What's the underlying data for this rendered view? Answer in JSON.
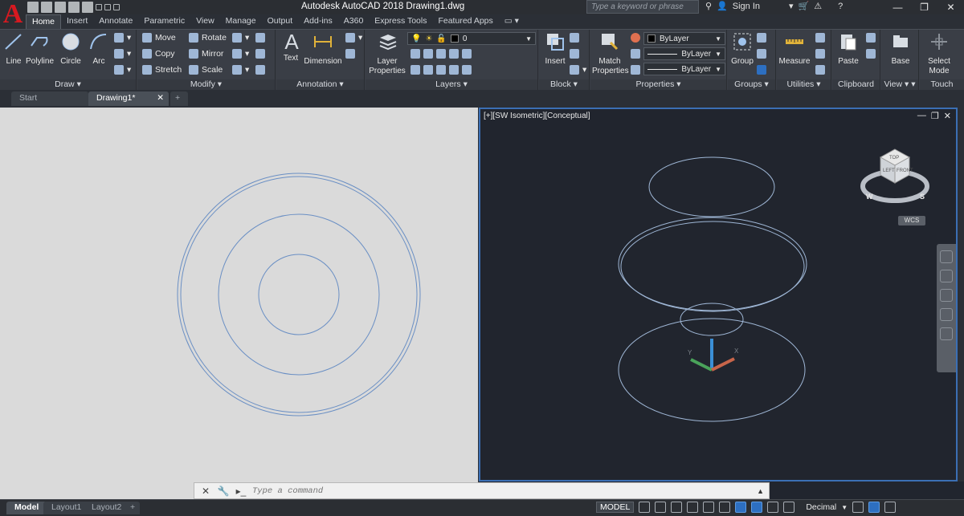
{
  "app": {
    "title": "Autodesk AutoCAD 2018    Drawing1.dwg",
    "logo_letter": "A"
  },
  "search": {
    "placeholder": "Type a keyword or phrase"
  },
  "account": {
    "sign_in": "Sign In"
  },
  "ribbon_tabs": [
    "Home",
    "Insert",
    "Annotate",
    "Parametric",
    "View",
    "Manage",
    "Output",
    "Add-ins",
    "A360",
    "Express Tools",
    "Featured Apps"
  ],
  "draw": {
    "title": "Draw",
    "line": "Line",
    "polyline": "Polyline",
    "circle": "Circle",
    "arc": "Arc"
  },
  "modify": {
    "title": "Modify",
    "move": "Move",
    "rotate": "Rotate",
    "copy": "Copy",
    "mirror": "Mirror",
    "stretch": "Stretch",
    "scale": "Scale"
  },
  "annotation": {
    "title": "Annotation",
    "text": "Text",
    "dimension": "Dimension"
  },
  "layers": {
    "title": "Layers",
    "layer_props_1": "Layer",
    "layer_props_2": "Properties",
    "current_layer": "0"
  },
  "block": {
    "title": "Block",
    "insert": "Insert"
  },
  "properties": {
    "title": "Properties",
    "match_1": "Match",
    "match_2": "Properties",
    "color": "ByLayer",
    "linetype": "ByLayer",
    "lineweight": "ByLayer"
  },
  "groups": {
    "title": "Groups",
    "group": "Group"
  },
  "utilities": {
    "title": "Utilities",
    "measure": "Measure"
  },
  "clipboard": {
    "title": "Clipboard",
    "paste": "Paste"
  },
  "view": {
    "title": "View",
    "base": "Base"
  },
  "touch": {
    "title": "Touch",
    "select_1": "Select",
    "select_2": "Mode"
  },
  "doc_tabs": {
    "start": "Start",
    "drawing": "Drawing1*"
  },
  "viewport_right": {
    "label": "[+][SW Isometric][Conceptual]",
    "wcs": "WCS",
    "cube_top": "TOP",
    "cube_left": "LEFT",
    "cube_front": "FRONT",
    "compass_w": "W",
    "compass_s": "S"
  },
  "command": {
    "placeholder": "Type a command"
  },
  "layout_tabs": {
    "model": "Model",
    "layout1": "Layout1",
    "layout2": "Layout2"
  },
  "status": {
    "model": "MODEL",
    "units": "Decimal"
  },
  "colors": {
    "accent": "#2d6fc1",
    "viewport_dark": "#21252e",
    "viewport_light": "#dadada",
    "circle_stroke": "#6a8fc4"
  }
}
